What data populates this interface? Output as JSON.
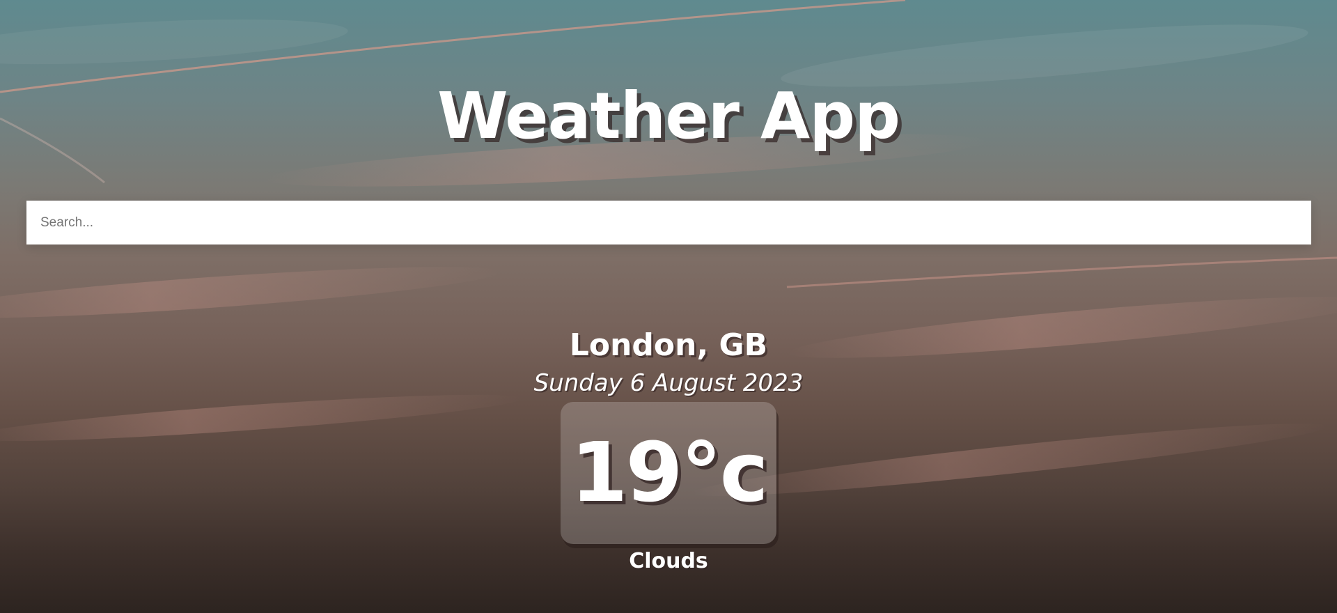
{
  "app": {
    "title": "Weather App"
  },
  "search": {
    "placeholder": "Search...",
    "value": ""
  },
  "location": {
    "name": "London, GB",
    "date": "Sunday 6 August 2023"
  },
  "weather": {
    "temperature": "19°c",
    "condition": "Clouds"
  },
  "colors": {
    "text": "#ffffff",
    "search_background": "#ffffff",
    "sky_top": "#5f8a8f",
    "sky_bottom": "#2d2420"
  }
}
